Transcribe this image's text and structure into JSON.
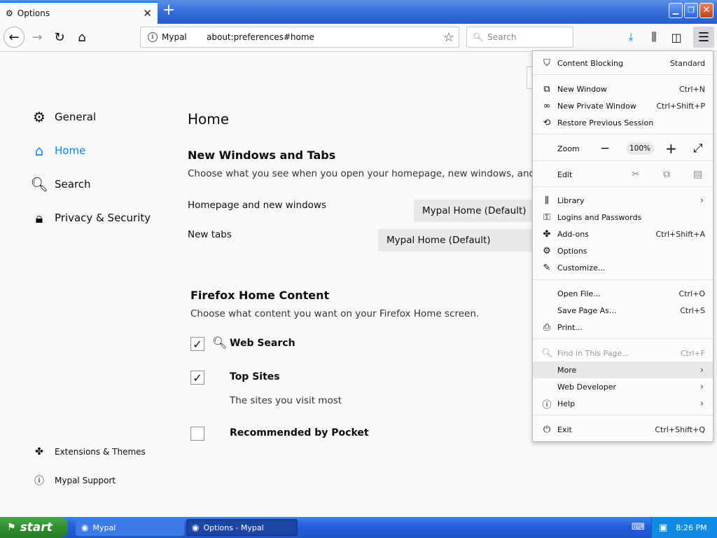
{
  "browser": {
    "tab_title": "Options",
    "tab_close": "✕",
    "new_tab": "+",
    "identity": "Mypal",
    "url": "about:preferences#home",
    "search_placeholder": "Search"
  },
  "sidebar": {
    "items": [
      {
        "label": "General",
        "icon": "gear-icon",
        "selected": false
      },
      {
        "label": "Home",
        "icon": "home-icon",
        "selected": true
      },
      {
        "label": "Search",
        "icon": "search-icon",
        "selected": false
      },
      {
        "label": "Privacy & Security",
        "icon": "lock-icon",
        "selected": false
      }
    ],
    "footer": [
      {
        "label": "Extensions & Themes",
        "icon": "puzzle-icon"
      },
      {
        "label": "Mypal Support",
        "icon": "help-icon"
      }
    ]
  },
  "main": {
    "title": "Home",
    "windows_tabs": {
      "title": "New Windows and Tabs",
      "description": "Choose what you see when you open your homepage, new windows, and new t",
      "homepage_label": "Homepage and new windows",
      "homepage_value": "Mypal Home (Default)",
      "newtabs_label": "New tabs",
      "newtabs_value": "Mypal Home (Default)"
    },
    "home_content": {
      "title": "Firefox Home Content",
      "description": "Choose what content you want on your Firefox Home screen.",
      "web_search": {
        "label": "Web Search",
        "checked": true
      },
      "top_sites": {
        "label": "Top Sites",
        "checked": true,
        "description": "The sites you visit most"
      },
      "pocket": {
        "label": "Recommended by Pocket",
        "checked": false
      }
    }
  },
  "app_menu": {
    "content_blocking": {
      "label": "Content Blocking",
      "value": "Standard"
    },
    "new_window": {
      "label": "New Window",
      "shortcut": "Ctrl+N"
    },
    "new_private_window": {
      "label": "New Private Window",
      "shortcut": "Ctrl+Shift+P"
    },
    "restore_session": {
      "label": "Restore Previous Session"
    },
    "zoom": {
      "label": "Zoom",
      "value": "100%"
    },
    "edit": {
      "label": "Edit"
    },
    "library": {
      "label": "Library"
    },
    "logins": {
      "label": "Logins and Passwords"
    },
    "addons": {
      "label": "Add-ons",
      "shortcut": "Ctrl+Shift+A"
    },
    "options": {
      "label": "Options"
    },
    "customize": {
      "label": "Customize..."
    },
    "open_file": {
      "label": "Open File...",
      "shortcut": "Ctrl+O"
    },
    "save_page": {
      "label": "Save Page As...",
      "shortcut": "Ctrl+S"
    },
    "print": {
      "label": "Print..."
    },
    "find": {
      "label": "Find in This Page...",
      "shortcut": "Ctrl+F"
    },
    "more": {
      "label": "More"
    },
    "web_developer": {
      "label": "Web Developer"
    },
    "help": {
      "label": "Help"
    },
    "exit": {
      "label": "Exit",
      "shortcut": "Ctrl+Shift+Q"
    }
  },
  "taskbar": {
    "start": "start",
    "tasks": [
      {
        "label": "Mypal",
        "active": false
      },
      {
        "label": "Options - Mypal",
        "active": true
      }
    ],
    "clock": "8:26 PM"
  }
}
